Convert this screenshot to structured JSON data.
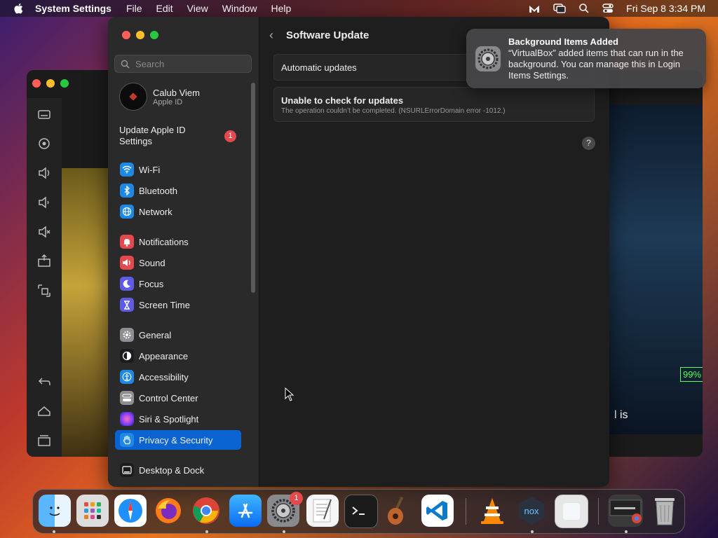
{
  "menubar": {
    "app_name": "System Settings",
    "menus": [
      "File",
      "Edit",
      "View",
      "Window",
      "Help"
    ],
    "clock": "Fri Sep 8  3:34 PM"
  },
  "sidebar": {
    "search_placeholder": "Search",
    "profile": {
      "name": "Calub Viem",
      "subtitle": "Apple ID"
    },
    "update_apple_id": {
      "label": "Update Apple ID Settings",
      "badge": "1"
    },
    "items": [
      {
        "label": "Wi-Fi",
        "color": "#1e88e5",
        "icon": "wifi-icon"
      },
      {
        "label": "Bluetooth",
        "color": "#1e88e5",
        "icon": "bluetooth-icon"
      },
      {
        "label": "Network",
        "color": "#1e88e5",
        "icon": "globe-icon"
      },
      {
        "label": "Notifications",
        "color": "#e5484d",
        "icon": "bell-icon"
      },
      {
        "label": "Sound",
        "color": "#e5484d",
        "icon": "speaker-icon"
      },
      {
        "label": "Focus",
        "color": "#5e5ce6",
        "icon": "moon-icon"
      },
      {
        "label": "Screen Time",
        "color": "#5e5ce6",
        "icon": "hourglass-icon"
      },
      {
        "label": "General",
        "color": "#8e8e93",
        "icon": "gear-icon"
      },
      {
        "label": "Appearance",
        "color": "#1c1c1e",
        "icon": "appearance-icon"
      },
      {
        "label": "Accessibility",
        "color": "#1e88e5",
        "icon": "accessibility-icon"
      },
      {
        "label": "Control Center",
        "color": "#8e8e93",
        "icon": "toggles-icon"
      },
      {
        "label": "Siri & Spotlight",
        "color": "#b34fd8",
        "icon": "siri-icon"
      },
      {
        "label": "Privacy & Security",
        "color": "#1e88e5",
        "icon": "hand-icon",
        "selected": true
      },
      {
        "label": "Desktop & Dock",
        "color": "#1c1c1e",
        "icon": "dock-icon"
      }
    ]
  },
  "main": {
    "title": "Software Update",
    "automatic_updates": "Automatic updates",
    "error_title": "Unable to check for updates",
    "error_detail": "The operation couldn’t be completed. (NSURLErrorDomain error -1012.)",
    "help": "?"
  },
  "notification": {
    "title": "Background Items Added",
    "body": "“VirtualBox” added items that can run in the background. You can manage this in Login Items Settings."
  },
  "background_window": {
    "progress_label": "99%",
    "caption_text": "l is"
  },
  "dock": {
    "items": [
      "Finder",
      "Launchpad",
      "Safari",
      "Firefox",
      "Chrome",
      "App Store",
      "System Settings",
      "TextEdit",
      "Terminal",
      "GarageBand",
      "Visual Studio Code",
      "VLC",
      "Nox",
      "Preview",
      "Chrome window",
      "Trash"
    ],
    "settings_badge": "1"
  }
}
